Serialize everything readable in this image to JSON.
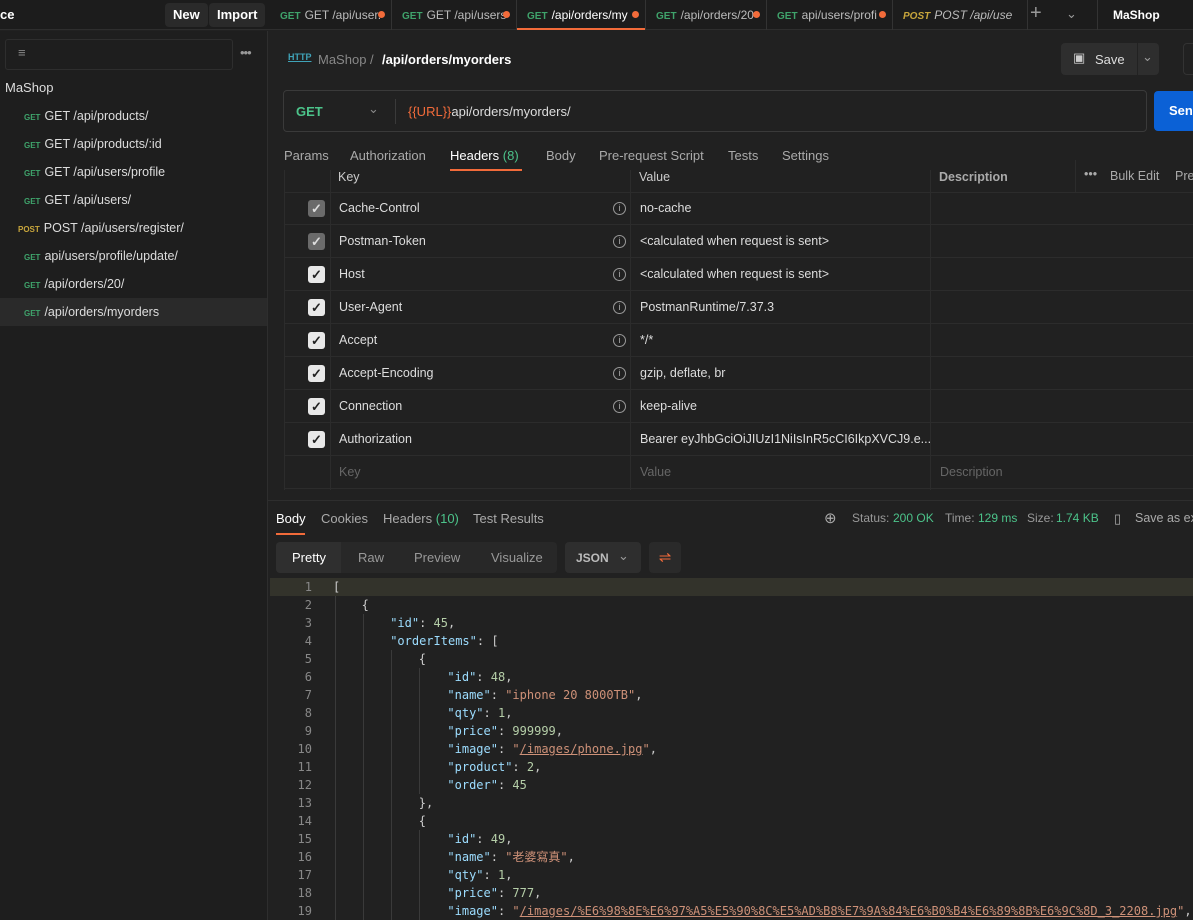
{
  "topbar": {
    "workspace_fragment": "ce",
    "new_label": "New",
    "import_label": "Import",
    "environment": "MaShop",
    "tabs": [
      {
        "method": "GET",
        "label": "GET /api/user."
      },
      {
        "method": "GET",
        "label": "GET /api/users"
      },
      {
        "method": "GET",
        "label": "/api/orders/my",
        "active": true
      },
      {
        "method": "GET",
        "label": "/api/orders/20"
      },
      {
        "method": "GET",
        "label": "api/users/profi"
      },
      {
        "method": "POST",
        "label": "POST /api/use"
      }
    ]
  },
  "sidebar": {
    "collection": "MaShop",
    "items": [
      {
        "method": "GET",
        "label": "GET /api/products/"
      },
      {
        "method": "GET",
        "label": "GET /api/products/:id"
      },
      {
        "method": "GET",
        "label": "GET /api/users/profile"
      },
      {
        "method": "GET",
        "label": "GET /api/users/"
      },
      {
        "method": "POST",
        "label": "POST /api/users/register/"
      },
      {
        "method": "GET",
        "label": "api/users/profile/update/"
      },
      {
        "method": "GET",
        "label": "/api/orders/20/"
      },
      {
        "method": "GET",
        "label": "/api/orders/myorders",
        "selected": true
      }
    ]
  },
  "request": {
    "breadcrumb_parent": "MaShop",
    "breadcrumb_sep": "/",
    "title": "/api/orders/myorders",
    "save_label": "Save",
    "method": "GET",
    "url_var": "{{URL}}",
    "url_path": "api/orders/myorders/",
    "send_label": "Send",
    "tabs": [
      "Params",
      "Authorization",
      "Headers",
      "Body",
      "Pre-request Script",
      "Tests",
      "Settings"
    ],
    "headers_count": "(8)",
    "columns": {
      "key": "Key",
      "value": "Value",
      "description": "Description",
      "bulk_edit": "Bulk Edit",
      "presets": "Presets"
    },
    "headers": [
      {
        "key": "Cache-Control",
        "value": "no-cache",
        "checked": true,
        "disabled": true,
        "info": true
      },
      {
        "key": "Postman-Token",
        "value": "<calculated when request is sent>",
        "checked": true,
        "disabled": true,
        "info": true
      },
      {
        "key": "Host",
        "value": "<calculated when request is sent>",
        "checked": true,
        "info": true
      },
      {
        "key": "User-Agent",
        "value": "PostmanRuntime/7.37.3",
        "checked": true,
        "info": true
      },
      {
        "key": "Accept",
        "value": "*/*",
        "checked": true,
        "info": true
      },
      {
        "key": "Accept-Encoding",
        "value": "gzip, deflate, br",
        "checked": true,
        "info": true
      },
      {
        "key": "Connection",
        "value": "keep-alive",
        "checked": true,
        "info": true
      },
      {
        "key": "Authorization",
        "value": "Bearer eyJhbGciOiJIUzI1NiIsInR5cCI6IkpXVCJ9.e...",
        "checked": true,
        "info": false
      }
    ],
    "placeholders": {
      "key": "Key",
      "value": "Value",
      "description": "Description"
    }
  },
  "response": {
    "tabs": [
      "Body",
      "Cookies",
      "Headers",
      "Test Results"
    ],
    "headers_count": "(10)",
    "status_label": "Status:",
    "status": "200 OK",
    "time_label": "Time:",
    "time": "129 ms",
    "size_label": "Size:",
    "size": "1.74 KB",
    "save_label": "Save as example",
    "views": [
      "Pretty",
      "Raw",
      "Preview",
      "Visualize"
    ],
    "format": "JSON",
    "colors": {
      "ok": "#4cc38a",
      "accent": "#f26b3a"
    },
    "lines": [
      [
        0,
        [
          [
            "p",
            "["
          ]
        ]
      ],
      [
        1,
        [
          [
            "p",
            "{"
          ]
        ]
      ],
      [
        2,
        [
          [
            "k",
            "\"id\""
          ],
          [
            "p",
            ": "
          ],
          [
            "n",
            "45"
          ],
          [
            "p",
            ","
          ]
        ]
      ],
      [
        2,
        [
          [
            "k",
            "\"orderItems\""
          ],
          [
            "p",
            ": ["
          ]
        ]
      ],
      [
        3,
        [
          [
            "p",
            "{"
          ]
        ]
      ],
      [
        4,
        [
          [
            "k",
            "\"id\""
          ],
          [
            "p",
            ": "
          ],
          [
            "n",
            "48"
          ],
          [
            "p",
            ","
          ]
        ]
      ],
      [
        4,
        [
          [
            "k",
            "\"name\""
          ],
          [
            "p",
            ": "
          ],
          [
            "s",
            "\"iphone 20 8000TB\""
          ],
          [
            "p",
            ","
          ]
        ]
      ],
      [
        4,
        [
          [
            "k",
            "\"qty\""
          ],
          [
            "p",
            ": "
          ],
          [
            "n",
            "1"
          ],
          [
            "p",
            ","
          ]
        ]
      ],
      [
        4,
        [
          [
            "k",
            "\"price\""
          ],
          [
            "p",
            ": "
          ],
          [
            "n",
            "999999"
          ],
          [
            "p",
            ","
          ]
        ]
      ],
      [
        4,
        [
          [
            "k",
            "\"image\""
          ],
          [
            "p",
            ": "
          ],
          [
            "s",
            "\""
          ],
          [
            "u",
            "/images/phone.jpg"
          ],
          [
            "s",
            "\""
          ],
          [
            "p",
            ","
          ]
        ]
      ],
      [
        4,
        [
          [
            "k",
            "\"product\""
          ],
          [
            "p",
            ": "
          ],
          [
            "n",
            "2"
          ],
          [
            "p",
            ","
          ]
        ]
      ],
      [
        4,
        [
          [
            "k",
            "\"order\""
          ],
          [
            "p",
            ": "
          ],
          [
            "n",
            "45"
          ]
        ]
      ],
      [
        3,
        [
          [
            "p",
            "},"
          ]
        ]
      ],
      [
        3,
        [
          [
            "p",
            "{"
          ]
        ]
      ],
      [
        4,
        [
          [
            "k",
            "\"id\""
          ],
          [
            "p",
            ": "
          ],
          [
            "n",
            "49"
          ],
          [
            "p",
            ","
          ]
        ]
      ],
      [
        4,
        [
          [
            "k",
            "\"name\""
          ],
          [
            "p",
            ": "
          ],
          [
            "s",
            "\"老婆寫真\""
          ],
          [
            "p",
            ","
          ]
        ]
      ],
      [
        4,
        [
          [
            "k",
            "\"qty\""
          ],
          [
            "p",
            ": "
          ],
          [
            "n",
            "1"
          ],
          [
            "p",
            ","
          ]
        ]
      ],
      [
        4,
        [
          [
            "k",
            "\"price\""
          ],
          [
            "p",
            ": "
          ],
          [
            "n",
            "777"
          ],
          [
            "p",
            ","
          ]
        ]
      ],
      [
        4,
        [
          [
            "k",
            "\"image\""
          ],
          [
            "p",
            ": "
          ],
          [
            "s",
            "\""
          ],
          [
            "u",
            "/images/%E6%98%8E%E6%97%A5%E5%90%8C%E5%AD%B8%E7%9A%84%E6%B0%B4%E6%89%8B%E6%9C%8D_3_2208.jpg"
          ],
          [
            "s",
            "\""
          ],
          [
            "p",
            ","
          ]
        ]
      ]
    ]
  }
}
